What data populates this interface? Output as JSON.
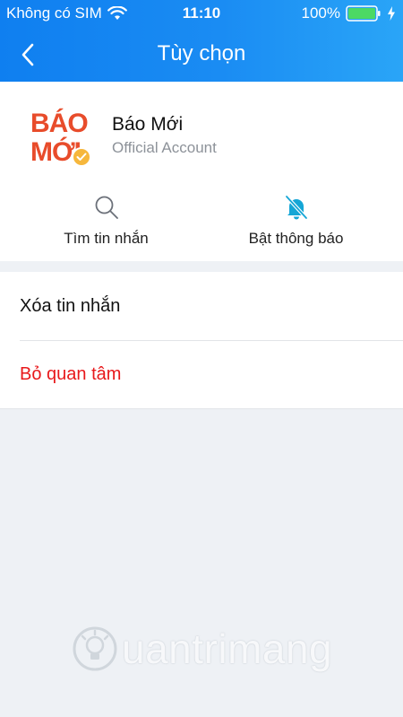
{
  "status_bar": {
    "carrier": "Không có SIM",
    "time": "11:10",
    "battery": "100%"
  },
  "nav": {
    "title": "Tùy chọn"
  },
  "profile": {
    "avatar_line1": "BÁO",
    "avatar_line2": "MỚI",
    "name": "Báo Mới",
    "subtitle": "Official Account"
  },
  "actions": [
    {
      "label": "Tìm tin nhắn",
      "icon": "search-icon"
    },
    {
      "label": "Bật thông báo",
      "icon": "bell-muted-icon"
    }
  ],
  "list": [
    {
      "label": "Xóa tin nhắn"
    },
    {
      "label": "Bỏ quan tâm"
    }
  ],
  "watermark": {
    "text": "uantrimang"
  },
  "colors": {
    "header_start": "#0f7ff0",
    "header_end": "#2aa5f7",
    "accent": "#1a8cf3",
    "danger": "#e8181b",
    "brand": "#e84c2b"
  }
}
